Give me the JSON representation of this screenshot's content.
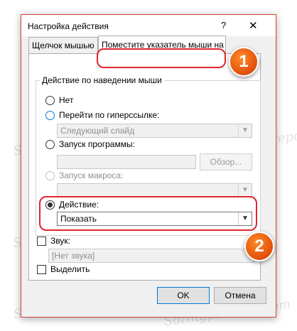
{
  "window": {
    "title": "Настройка действия",
    "help": "?",
    "close": "✕"
  },
  "tabs": [
    {
      "label": "Щелчок мышью"
    },
    {
      "label": "Поместите указатель мыши на"
    }
  ],
  "group": {
    "label": "Действие по наведении мыши",
    "options": {
      "none": "Нет",
      "hyperlink": "Перейти по гиперссылке:",
      "hyperlink_value": "Следующий слайд",
      "program": "Запуск программы:",
      "browse_button": "Обзор...",
      "macro": "Запуск макроса:",
      "action": "Действие:",
      "action_value": "Показать"
    }
  },
  "sound": {
    "label": "Звук:",
    "value": "[Нет звука]"
  },
  "highlight": {
    "label": "Выделить"
  },
  "buttons": {
    "ok": "OK",
    "cancel": "Отмена"
  },
  "badges": {
    "one": "1",
    "two": "2"
  },
  "watermark": "Soringpcrepair.com",
  "colors": {
    "annotation_red": "#e0262e",
    "badge_orange": "#e3530c"
  }
}
